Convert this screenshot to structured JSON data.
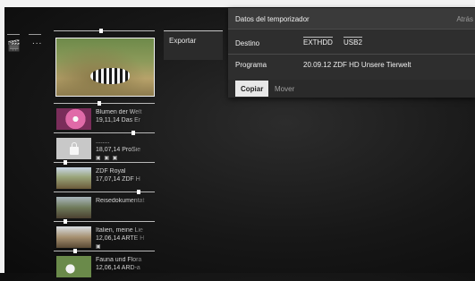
{
  "export_panel": {
    "label": "Exportar"
  },
  "timer_dialog": {
    "title": "Datos del temporizador",
    "back": "Atrás",
    "destino_label": "Destino",
    "destino_options": [
      "EXTHDD",
      "USB2"
    ],
    "programa_label": "Programa",
    "programa_value": "20.09.12 ZDF HD Unsere Tierwelt",
    "buttons": {
      "copy": "Copiar",
      "move": "Mover"
    }
  },
  "left_column": {
    "dots": "..."
  },
  "recordings": [
    {
      "line1": "Blumen der Welt",
      "line2": "19,11,14 Das Er",
      "icons": "",
      "thumb": "flower",
      "progress": 0.45
    },
    {
      "line1": "........",
      "line2": "18,07,14 ProSie",
      "icons": "▣ ▣ ▣",
      "thumb": "lock",
      "progress": 0.8
    },
    {
      "line1": "ZDF Royal",
      "line2": "17,07,14 ZDF H",
      "icons": "",
      "thumb": "wildlife",
      "progress": 0.1
    },
    {
      "line1": "Reisedokumentat",
      "line2": "",
      "icons": "",
      "thumb": "landscape",
      "progress": 0.85
    },
    {
      "line1": "Italien, meine Lie",
      "line2": "12,06,14 ARTE H",
      "icons": "▣",
      "thumb": "italy",
      "progress": 0.1
    },
    {
      "line1": "Fauna und Flora",
      "line2": "12,06,14 ARD-a",
      "icons": "",
      "thumb": "flowers",
      "progress": 0.2
    }
  ],
  "featured": {
    "progress": 0.47
  },
  "colors": {
    "background": "#171717",
    "dialog": "#2e2e2e",
    "active_button": "#e8e8e8",
    "frame": "#f2f2f2"
  }
}
